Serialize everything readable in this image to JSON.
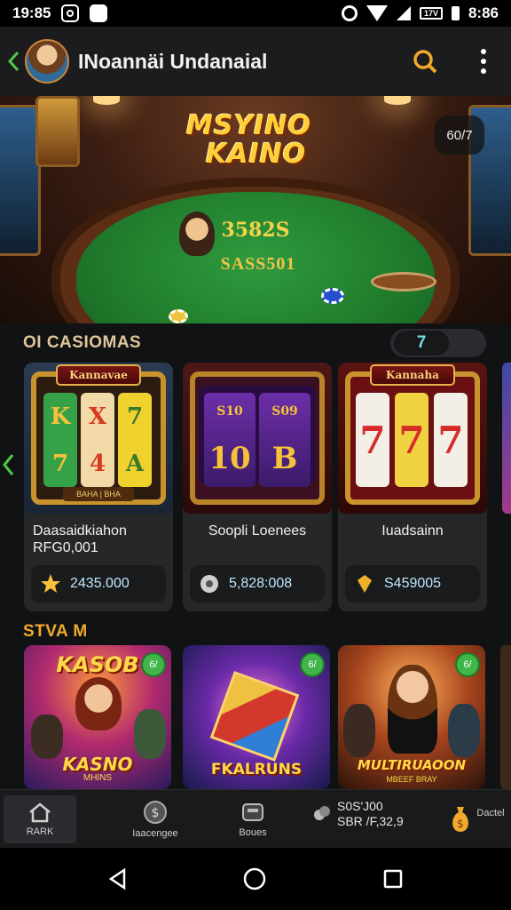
{
  "status_bar": {
    "time": "19:85",
    "right_time": "8:86",
    "battery_label": "17V",
    "icons": [
      "camera-icon",
      "app-icon",
      "alarm-icon",
      "wifi-icon",
      "signal-icon",
      "battery-icon"
    ]
  },
  "app_bar": {
    "title": "INoannäi Undanaial",
    "back_icon": "chevron-left-icon",
    "search_icon": "search-icon",
    "more_icon": "more-vertical-icon"
  },
  "hero": {
    "logo_line1": "MSYINO",
    "logo_line2": "KAINO",
    "felt_numbers": "3582S",
    "felt_text": "SASS501",
    "badge": "60/7"
  },
  "section_games": {
    "title": "OI CASIOMAS",
    "pill_value": "7"
  },
  "games": [
    {
      "banner": "Kannavae",
      "reels": [
        [
          "K",
          "7"
        ],
        [
          "X",
          "4"
        ],
        [
          "7",
          "A"
        ]
      ],
      "footer": "BAHA | BHA",
      "name": "Daasaidkiahon RFG0,001",
      "icon": "star-icon",
      "value": "2435.000",
      "accent": "#f7c23a"
    },
    {
      "banner": "",
      "reels": [
        [
          "S10",
          "10"
        ],
        [
          "S09",
          "B"
        ],
        [
          "",
          ""
        ]
      ],
      "footer": "",
      "name": "Soopli Loenees",
      "icon": "chip-icon",
      "value": "5,828:008",
      "accent": "#9ad6ff"
    },
    {
      "banner": "Kannaha",
      "reels": [
        [
          "7"
        ],
        [
          "7"
        ],
        [
          "7"
        ]
      ],
      "footer": "",
      "name": "Iuadsainn",
      "icon": "gem-icon",
      "value": "S459005",
      "accent": "#f0b22a"
    }
  ],
  "section_featured": {
    "title": "STVA M"
  },
  "featured": [
    {
      "title_top": "KASOB",
      "title_bottom": "KASNO",
      "sub": "MHINS",
      "badge": "6/"
    },
    {
      "title_top": "",
      "title_bottom": "FKALRUNS",
      "sub": "",
      "badge": "6/"
    },
    {
      "title_top": "",
      "title_bottom": "MULTIRUAOON",
      "sub": "MBEEF BRAY",
      "badge": "6/"
    }
  ],
  "bottom_nav": {
    "items": [
      {
        "label": "RARK",
        "icon": "home-icon",
        "active": true
      },
      {
        "label": "Iaacengee",
        "icon": "coin-icon",
        "active": false
      },
      {
        "label": "Boues",
        "icon": "wallet-icon",
        "active": false
      }
    ],
    "stats_line1": "S0S'J00",
    "stats_line2": "SBR /F,32,9",
    "last_label": "Dactel",
    "stats_icon": "coins-icon",
    "last_icon": "money-bag-icon"
  },
  "android_nav": {
    "icons": [
      "back-triangle-icon",
      "home-circle-icon",
      "recents-square-icon"
    ]
  },
  "colors": {
    "accent_gold": "#f0a92c",
    "felt_green": "#1f7a2b",
    "card_bg": "#262729"
  }
}
